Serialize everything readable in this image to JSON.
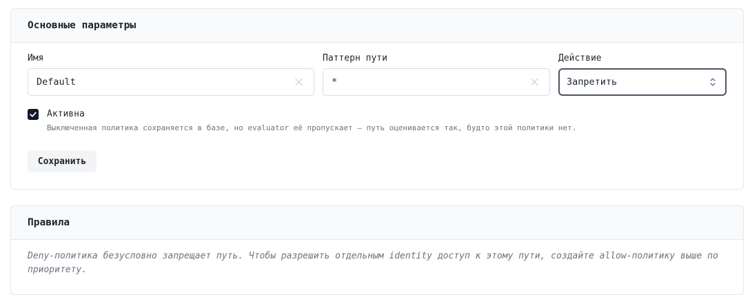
{
  "main_section": {
    "title": "Основные параметры",
    "name_field": {
      "label": "Имя",
      "value": "Default"
    },
    "path_field": {
      "label": "Паттерн пути",
      "value": "*"
    },
    "action_field": {
      "label": "Действие",
      "selected": "Запретить"
    },
    "active_checkbox": {
      "label": "Активна",
      "checked": true,
      "hint": "Выключенная политика сохраняется в базе, но evaluator её пропускает — путь оценивается так, будто этой политики нет."
    },
    "save_button": "Сохранить"
  },
  "rules_section": {
    "title": "Правила",
    "description": "Deny-политика безусловно запрещает путь. Чтобы разрешить отдельным identity доступ к этому пути, создайте allow-политику выше по приоритету."
  },
  "icons": {
    "clear": "close-icon",
    "select": "chevron-up-down-icon",
    "checkbox": "check-icon"
  },
  "colors": {
    "checkbox_fill": "#111827",
    "select_border": "#4b5563",
    "muted_text": "#6b7280"
  }
}
